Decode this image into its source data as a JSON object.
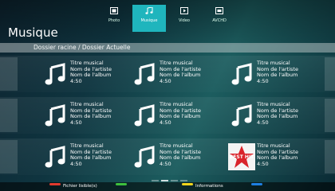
{
  "header": {
    "title": "Musique",
    "tabs": [
      {
        "label": "Photo",
        "icon": "photo-icon",
        "active": false
      },
      {
        "label": "Musique",
        "icon": "music-icon",
        "active": true
      },
      {
        "label": "Video",
        "icon": "video-icon",
        "active": false
      },
      {
        "label": "AVCHD",
        "icon": "avchd-icon",
        "active": false
      }
    ]
  },
  "breadcrumb": "Dossier racine / Dossier Actuelle",
  "rows": [
    [
      {
        "title": "Titre musical",
        "artist": "Nom de l'artiste",
        "album": "Nom de l'album",
        "duration": "4:50",
        "cover": "music-note-icon"
      },
      {
        "title": "Titre musical",
        "artist": "Nom de l'artiste",
        "album": "Nom de l'album",
        "duration": "4:50",
        "cover": "music-note-icon"
      },
      {
        "title": "Titre musical",
        "artist": "Nom de l'artiste",
        "album": "Nom de l'album",
        "duration": "4:50",
        "cover": "music-note-icon"
      }
    ],
    [
      {
        "title": "Titre musical",
        "artist": "Nom de l'artiste",
        "album": "Nom de l'album",
        "duration": "4:50",
        "cover": "music-note-icon"
      },
      {
        "title": "Titre musical",
        "artist": "Nom de l'artiste",
        "album": "Nom de l'album",
        "duration": "4:50",
        "cover": "music-note-icon"
      },
      {
        "title": "Titre musical",
        "artist": "Nom de l'artiste",
        "album": "Nom de l'album",
        "duration": "4:50",
        "cover": "music-note-icon"
      }
    ],
    [
      {
        "title": "Titre musical",
        "artist": "Nom de l'artiste",
        "album": "Nom de l'album",
        "duration": "4:50",
        "cover": "music-note-icon"
      },
      {
        "title": "Titre musical",
        "artist": "Nom de l'artiste",
        "album": "Nom de l'album",
        "duration": "4:50",
        "cover": "music-note-icon"
      },
      {
        "title": "Titre musical",
        "artist": "Nom de l'artiste",
        "album": "Nom de l'album",
        "duration": "4:50",
        "cover": "best-hit-album-art",
        "cover_text": "BEST HIT"
      }
    ]
  ],
  "pager": {
    "pages": 4,
    "current": 2
  },
  "color_keys": [
    {
      "color": "#e23a2e",
      "label": "Fichier lisible(s)"
    },
    {
      "color": "#3dbf3d",
      "label": ""
    },
    {
      "color": "#f2d51c",
      "label": "Informations"
    },
    {
      "color": "#1e7fe0",
      "label": ""
    }
  ],
  "colors": {
    "accent": "#1fb5bd",
    "background": "#12393f"
  }
}
